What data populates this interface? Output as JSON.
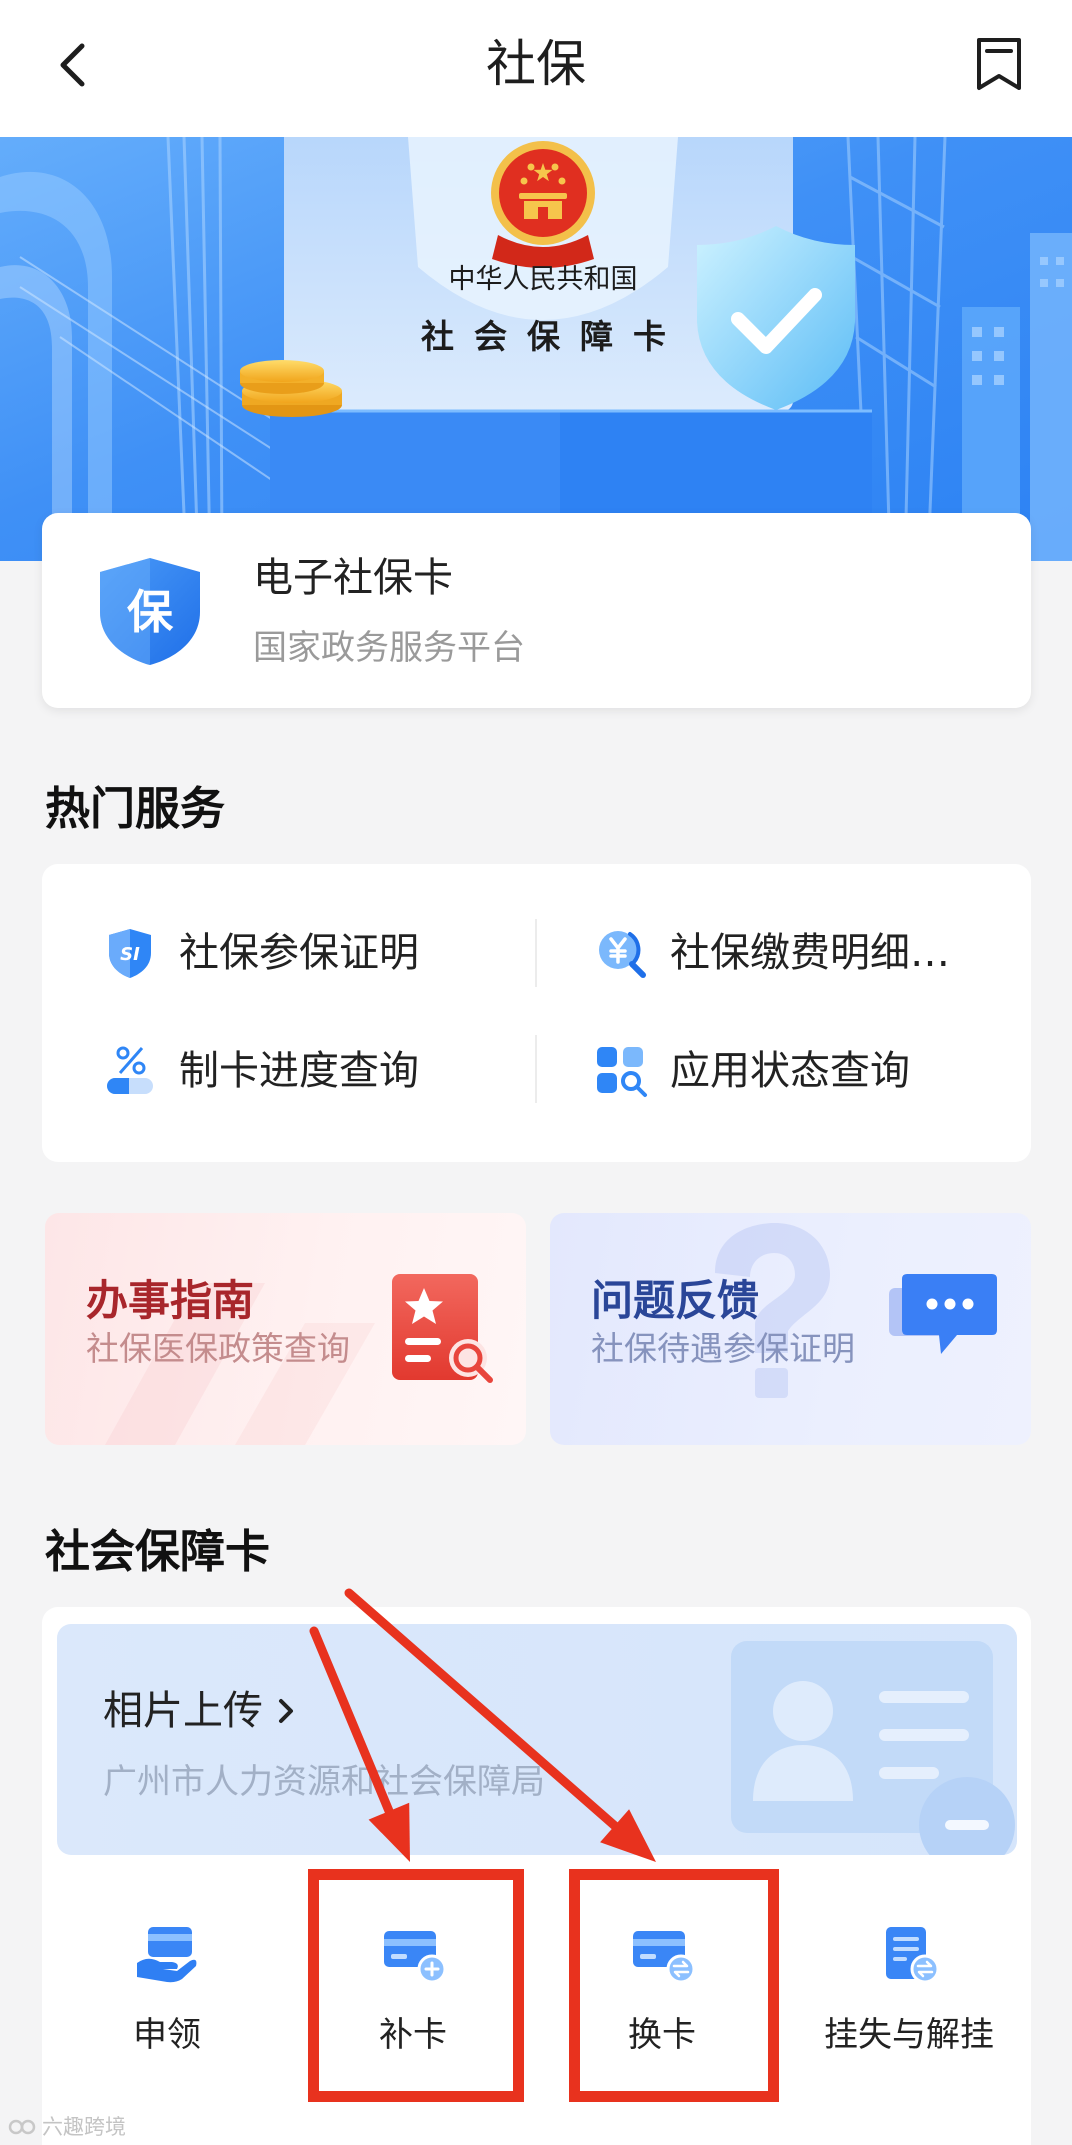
{
  "header": {
    "title": "社保",
    "back_icon": "chevron-left-icon",
    "right_icon": "bookmark-icon"
  },
  "banner": {
    "country_text": "中华人民共和国",
    "card_text": "社会保障卡"
  },
  "ecard": {
    "icon": "shield-icon",
    "icon_char": "保",
    "title": "电子社保卡",
    "subtitle": "国家政务服务平台"
  },
  "hot_services": {
    "heading": "热门服务",
    "items": [
      {
        "label": "社保参保证明",
        "icon": "si-shield-icon",
        "icon_text": "SI"
      },
      {
        "label": "社保缴费明细…",
        "icon": "yen-search-icon"
      },
      {
        "label": "制卡进度查询",
        "icon": "progress-percent-icon"
      },
      {
        "label": "应用状态查询",
        "icon": "app-grid-search-icon"
      }
    ]
  },
  "promos": [
    {
      "title": "办事指南",
      "subtitle": "社保医保政策查询",
      "icon": "document-star-search-icon"
    },
    {
      "title": "问题反馈",
      "subtitle": "社保待遇参保证明",
      "icon": "chat-bubble-icon"
    }
  ],
  "social_card": {
    "heading": "社会保障卡",
    "photo_upload": {
      "title": "相片上传",
      "subtitle": "广州市人力资源和社会保障局",
      "icon": "id-card-icon"
    },
    "actions": [
      {
        "label": "申领",
        "icon": "hand-card-icon"
      },
      {
        "label": "补卡",
        "icon": "card-plus-icon"
      },
      {
        "label": "换卡",
        "icon": "card-swap-icon"
      },
      {
        "label": "挂失与解挂",
        "icon": "document-swap-icon"
      }
    ]
  },
  "watermark": "六趣跨境",
  "colors": {
    "accent": "#2f7ff3",
    "annotation_red": "#e8321e",
    "guide_title": "#a8262b",
    "feedback_title": "#2a4698",
    "page_bg": "#f4f4f5"
  }
}
